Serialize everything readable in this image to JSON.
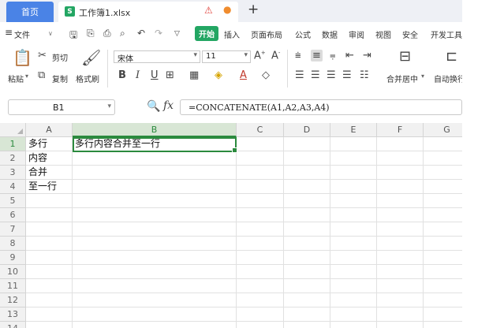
{
  "titlebar": {
    "home_tab": "首页",
    "file_tab": "工作簿1.xlsx",
    "file_icon_letter": "S",
    "new_tab": "+"
  },
  "menu": {
    "file": "文件",
    "items": [
      "开始",
      "插入",
      "页面布局",
      "公式",
      "数据",
      "审阅",
      "视图",
      "安全",
      "开发工具"
    ]
  },
  "ribbon": {
    "paste": "粘贴",
    "cut": "剪切",
    "copy": "复制",
    "format_painter": "格式刷",
    "font_name": "宋体",
    "font_size": "11",
    "bold": "B",
    "italic": "I",
    "underline": "U",
    "merge_center": "合并居中",
    "wrap": "自动换行"
  },
  "formula_bar": {
    "name_box": "B1",
    "fx": "fx",
    "formula": "=CONCATENATE(A1,A2,A3,A4)"
  },
  "sheet": {
    "columns": [
      "A",
      "B",
      "C",
      "D",
      "E",
      "F",
      "G"
    ],
    "rows": [
      "1",
      "2",
      "3",
      "4",
      "5",
      "6",
      "7",
      "8",
      "9",
      "10",
      "11",
      "12",
      "13",
      "14"
    ],
    "cells": {
      "A1": "多行",
      "A2": "内容",
      "A3": "合并",
      "A4": "至一行",
      "B1": "多行内容合并至一行"
    },
    "selected_cell": "B1"
  }
}
